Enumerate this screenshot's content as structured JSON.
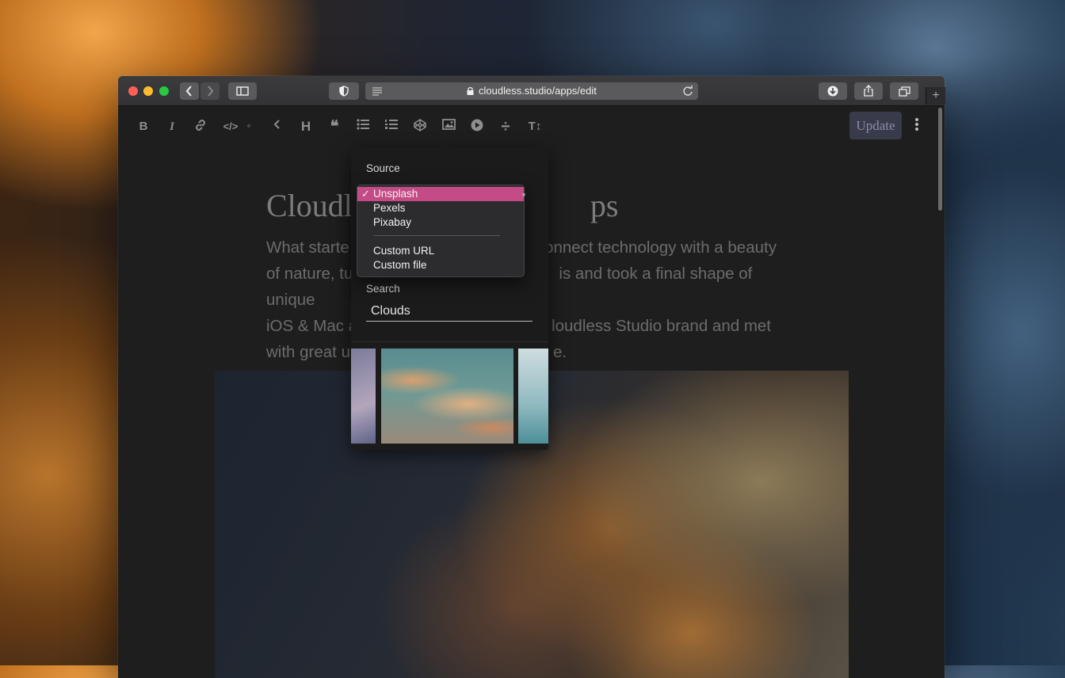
{
  "browser": {
    "url": "cloudless.studio/apps/edit"
  },
  "toolbar": {
    "tools": [
      {
        "icon": "bold-icon",
        "glyph": "B"
      },
      {
        "icon": "italic-icon",
        "glyph": "I"
      },
      {
        "icon": "link-icon",
        "glyph": ""
      },
      {
        "icon": "code-icon",
        "glyph": "</>"
      },
      {
        "icon": "chevron-left-icon",
        "glyph": ""
      },
      {
        "icon": "heading-icon",
        "glyph": "H"
      },
      {
        "icon": "quote-icon",
        "glyph": "❝"
      },
      {
        "icon": "bulleted-list-icon",
        "glyph": ""
      },
      {
        "icon": "numbered-list-icon",
        "glyph": ""
      },
      {
        "icon": "codepen-icon",
        "glyph": ""
      },
      {
        "icon": "image-icon",
        "glyph": ""
      },
      {
        "icon": "play-icon",
        "glyph": ""
      },
      {
        "icon": "divider-icon",
        "glyph": "÷"
      },
      {
        "icon": "text-size-icon",
        "glyph": "T↕"
      }
    ],
    "update_label": "Update"
  },
  "article": {
    "title_start": "Cloudl",
    "title_end": "ps",
    "body_lines": [
      {
        "left": "What starte",
        "right": "connect technology with a beauty"
      },
      {
        "left": "of nature, tu",
        "right": "is and took a final shape of unique"
      },
      {
        "left": "iOS & Mac a",
        "right": "loudless Studio brand and met"
      },
      {
        "left": "with great u",
        "right": "e."
      }
    ]
  },
  "image_picker": {
    "source_label": "Source",
    "search_label": "Search",
    "search_value": "Clouds",
    "source_options": [
      "Unsplash",
      "Pexels",
      "Pixabay",
      "Custom URL",
      "Custom file"
    ],
    "selected_source": "Unsplash",
    "check_glyph": "✓"
  },
  "colors": {
    "selected_option": "#c44b86",
    "update_button": "#3a3b4a"
  }
}
